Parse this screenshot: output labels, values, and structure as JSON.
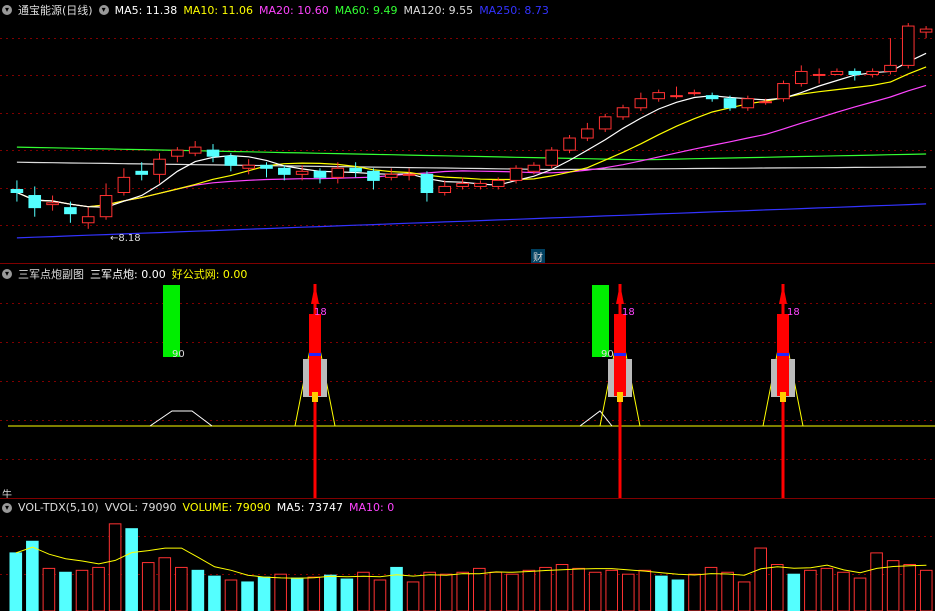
{
  "main": {
    "title": "通宝能源(日线)",
    "indicators": [
      {
        "label": "MA5: 11.38",
        "color": "#ffffff"
      },
      {
        "label": "MA10: 11.06",
        "color": "#ffff00"
      },
      {
        "label": "MA20: 10.60",
        "color": "#ff44ff"
      },
      {
        "label": "MA60: 9.49",
        "color": "#33ff33"
      },
      {
        "label": "MA120: 9.55",
        "color": "#dddddd"
      },
      {
        "label": "MA250: 8.73",
        "color": "#3333ff"
      }
    ],
    "low_label": "8.18",
    "fin_label": "财"
  },
  "sub": {
    "title": "三军点炮副图",
    "indicators": [
      {
        "label": "三军点炮: 0.00",
        "color": "#ffffff"
      },
      {
        "label": "好公式网: 0.00",
        "color": "#ffff00"
      }
    ],
    "signal_texts": [
      "90",
      "90"
    ],
    "rocket_texts": [
      "18",
      "18",
      "18"
    ],
    "bull_label": "牛"
  },
  "vol": {
    "title": "VOL-TDX(5,10)",
    "indicators": [
      {
        "label": "VVOL: 79090",
        "color": "#dddddd"
      },
      {
        "label": "VOLUME: 79090",
        "color": "#ffff00"
      },
      {
        "label": "MA5: 73747",
        "color": "#ffffff"
      },
      {
        "label": "MA10: 0",
        "color": "#ff44ff"
      }
    ]
  },
  "chart_data": {
    "type": "candlestick",
    "ylim": [
      8.0,
      11.8
    ],
    "candles": [
      [
        9.0,
        8.95,
        9.15,
        8.8
      ],
      [
        8.9,
        8.7,
        9.05,
        8.55
      ],
      [
        8.75,
        8.78,
        8.9,
        8.65
      ],
      [
        8.7,
        8.6,
        8.8,
        8.45
      ],
      [
        8.45,
        8.55,
        8.7,
        8.35
      ],
      [
        8.55,
        8.9,
        9.1,
        8.5
      ],
      [
        8.95,
        9.2,
        9.35,
        8.9
      ],
      [
        9.3,
        9.25,
        9.45,
        9.15
      ],
      [
        9.25,
        9.5,
        9.6,
        9.1
      ],
      [
        9.55,
        9.65,
        9.7,
        9.45
      ],
      [
        9.6,
        9.7,
        9.8,
        9.55
      ],
      [
        9.65,
        9.55,
        9.75,
        9.45
      ],
      [
        9.55,
        9.4,
        9.6,
        9.3
      ],
      [
        9.35,
        9.4,
        9.5,
        9.25
      ],
      [
        9.4,
        9.35,
        9.45,
        9.2
      ],
      [
        9.35,
        9.25,
        9.4,
        9.15
      ],
      [
        9.25,
        9.3,
        9.4,
        9.15
      ],
      [
        9.3,
        9.2,
        9.35,
        9.1
      ],
      [
        9.2,
        9.35,
        9.45,
        9.1
      ],
      [
        9.35,
        9.3,
        9.45,
        9.2
      ],
      [
        9.3,
        9.15,
        9.35,
        9.0
      ],
      [
        9.2,
        9.25,
        9.35,
        9.15
      ],
      [
        9.25,
        9.25,
        9.35,
        9.15
      ],
      [
        9.25,
        8.95,
        9.3,
        8.8
      ],
      [
        8.95,
        9.05,
        9.15,
        8.9
      ],
      [
        9.05,
        9.1,
        9.2,
        9.0
      ],
      [
        9.05,
        9.1,
        9.15,
        9.0
      ],
      [
        9.05,
        9.15,
        9.2,
        9.0
      ],
      [
        9.15,
        9.35,
        9.4,
        9.1
      ],
      [
        9.3,
        9.4,
        9.45,
        9.25
      ],
      [
        9.4,
        9.65,
        9.7,
        9.35
      ],
      [
        9.65,
        9.85,
        9.9,
        9.6
      ],
      [
        9.85,
        10.0,
        10.1,
        9.8
      ],
      [
        10.0,
        10.2,
        10.25,
        9.95
      ],
      [
        10.2,
        10.35,
        10.4,
        10.15
      ],
      [
        10.35,
        10.5,
        10.6,
        10.3
      ],
      [
        10.5,
        10.6,
        10.65,
        10.45
      ],
      [
        10.55,
        10.55,
        10.7,
        10.5
      ],
      [
        10.6,
        10.6,
        10.65,
        10.55
      ],
      [
        10.55,
        10.5,
        10.6,
        10.45
      ],
      [
        10.5,
        10.35,
        10.55,
        10.3
      ],
      [
        10.35,
        10.5,
        10.55,
        10.3
      ],
      [
        10.45,
        10.45,
        10.5,
        10.4
      ],
      [
        10.5,
        10.75,
        10.8,
        10.45
      ],
      [
        10.75,
        10.95,
        11.05,
        10.7
      ],
      [
        10.9,
        10.9,
        11.0,
        10.75
      ],
      [
        10.9,
        10.95,
        11.0,
        10.9
      ],
      [
        10.95,
        10.9,
        11.0,
        10.8
      ],
      [
        10.9,
        10.95,
        11.0,
        10.85
      ],
      [
        10.95,
        11.05,
        11.5,
        10.9
      ],
      [
        11.05,
        11.7,
        11.75,
        11.0
      ],
      [
        11.6,
        11.65,
        11.7,
        11.5
      ]
    ],
    "volumes": [
      60,
      72,
      44,
      40,
      42,
      45,
      90,
      85,
      50,
      55,
      45,
      42,
      36,
      32,
      30,
      35,
      38,
      34,
      35,
      37,
      33,
      40,
      32,
      45,
      30,
      40,
      38,
      40,
      44,
      40,
      38,
      42,
      45,
      48,
      44,
      40,
      42,
      38,
      42,
      36,
      32,
      38,
      45,
      40,
      30,
      65,
      48,
      38,
      42,
      44,
      40,
      34,
      60,
      52,
      48,
      42
    ]
  }
}
